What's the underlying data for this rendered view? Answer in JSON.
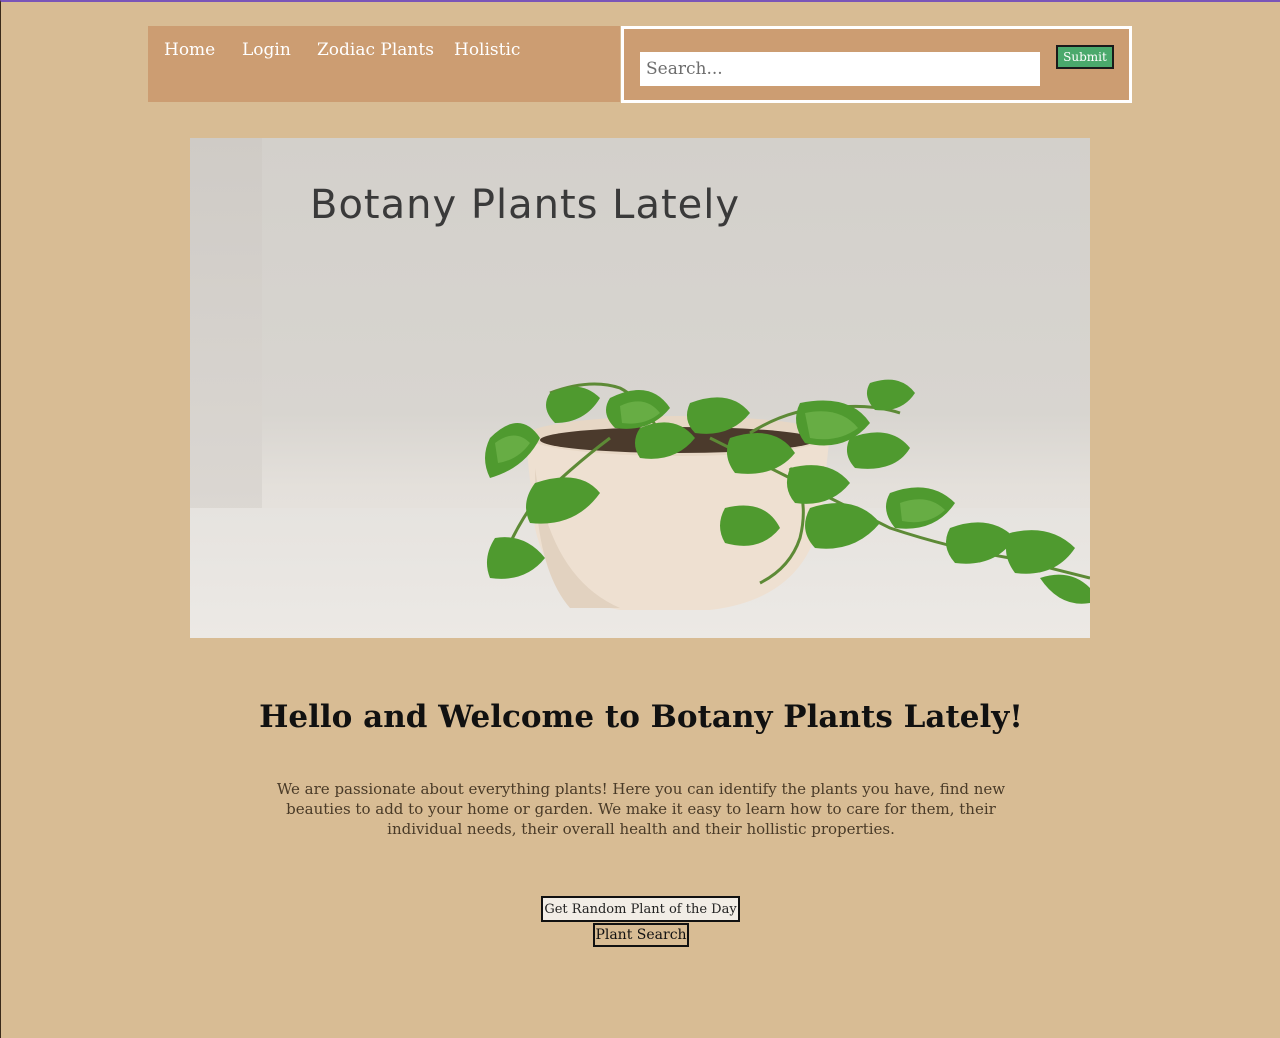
{
  "nav": {
    "items": [
      {
        "label": "Home"
      },
      {
        "label": "Login"
      },
      {
        "label": "Zodiac Plants"
      },
      {
        "label": "Holistic"
      }
    ]
  },
  "search": {
    "placeholder": "Search...",
    "submit_label": "Submit"
  },
  "hero": {
    "title": "Botany Plants Lately"
  },
  "main": {
    "heading": "Hello and Welcome to Botany Plants Lately!",
    "intro": "We are passionate about everything plants! Here you can identify the plants you have, find new beauties to add to your home or garden. We make it easy to learn how to care for them, their individual needs, their overall health and their hollistic properties.",
    "random_button": "Get Random Plant of the Day",
    "plant_search_button": "Plant Search"
  },
  "colors": {
    "page_background": "#d8bc94",
    "nav_background": "#cc9d72",
    "submit_button": "#4aa96c"
  }
}
